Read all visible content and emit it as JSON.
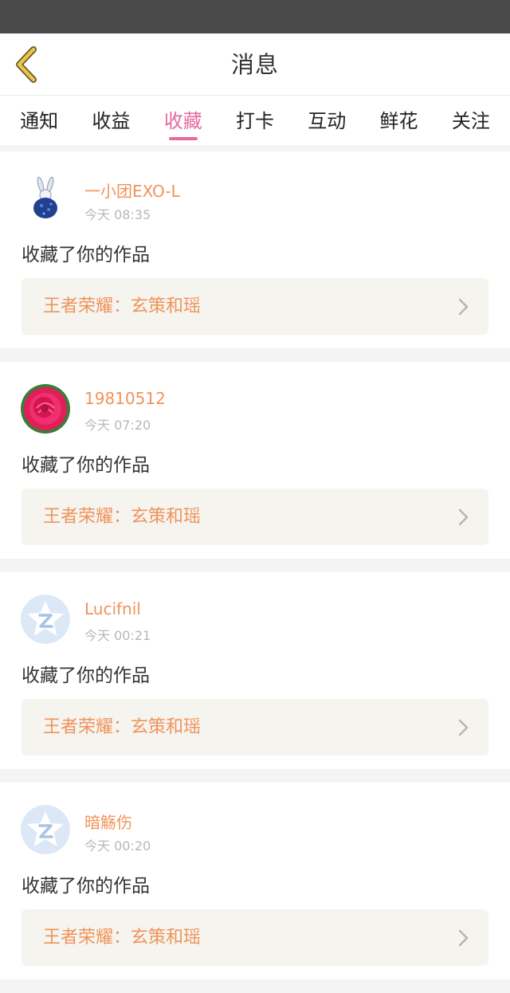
{
  "header": {
    "title": "消息",
    "back_icon": "chevron-left-icon",
    "back_color": "#e8c74a"
  },
  "tabs": [
    {
      "label": "通知",
      "active": false
    },
    {
      "label": "收益",
      "active": false
    },
    {
      "label": "收藏",
      "active": true
    },
    {
      "label": "打卡",
      "active": false
    },
    {
      "label": "互动",
      "active": false
    },
    {
      "label": "鲜花",
      "active": false
    },
    {
      "label": "关注",
      "active": false
    }
  ],
  "colors": {
    "accent": "#e56aa0",
    "username": "#f0935a",
    "timestamp": "#b8b8b8"
  },
  "feed": [
    {
      "username": "一小团EXO-L",
      "time": "今天 08:35",
      "action": "收藏了你的作品",
      "work_title": "王者荣耀：玄策和瑶",
      "avatar": "rabbit-figure-avatar"
    },
    {
      "username": "19810512",
      "time": "今天 07:20",
      "action": "收藏了你的作品",
      "work_title": "王者荣耀：玄策和瑶",
      "avatar": "rose-flower-avatar"
    },
    {
      "username": "Lucifnil",
      "time": "今天 00:21",
      "action": "收藏了你的作品",
      "work_title": "王者荣耀：玄策和瑶",
      "avatar": "default-star-avatar"
    },
    {
      "username": "暗觞伤",
      "time": "今天 00:20",
      "action": "收藏了你的作品",
      "work_title": "王者荣耀：玄策和瑶",
      "avatar": "default-star-avatar"
    }
  ]
}
